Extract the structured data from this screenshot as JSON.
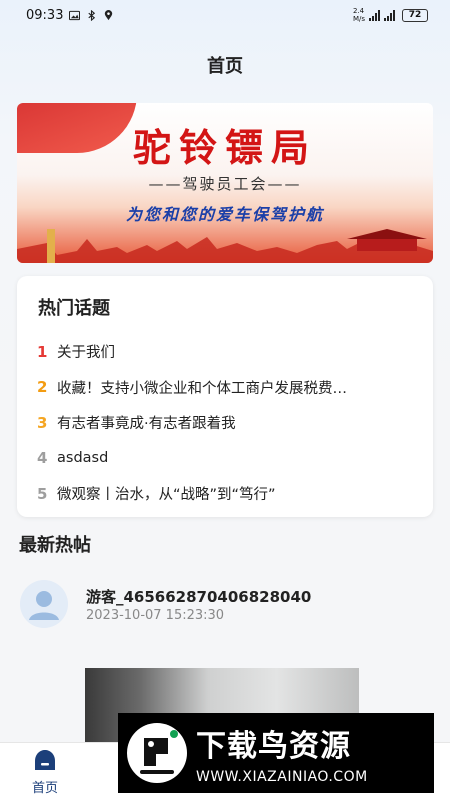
{
  "status_bar": {
    "time": "09:33",
    "net_speed": "2.4\nM/s",
    "battery": "72"
  },
  "header": {
    "title": "首页"
  },
  "banner": {
    "title": "驼铃镖局",
    "subtitle": "——驾驶员工会——",
    "slogan": "为您和您的爱车保驾护航"
  },
  "hot_topics": {
    "title": "热门话题",
    "items": [
      {
        "rank": "1",
        "text": "关于我们",
        "color": "#e53935"
      },
      {
        "rank": "2",
        "text": "收藏！支持小微企业和个体工商户发展税费…",
        "color": "#f39c12"
      },
      {
        "rank": "3",
        "text": "有志者事竟成·有志者跟着我",
        "color": "#f5a623"
      },
      {
        "rank": "4",
        "text": "asdasd",
        "color": "#9e9e9e"
      },
      {
        "rank": "5",
        "text": "微观察丨治水，从“战略”到“笃行”",
        "color": "#9e9e9e"
      }
    ]
  },
  "latest_posts": {
    "title": "最新热帖",
    "post": {
      "author": "游客_465662870406828040",
      "time": "2023-10-07 15:23:30"
    }
  },
  "bottom_nav": {
    "home_label": "首页",
    "accent": "#1c3f7a"
  },
  "watermark": {
    "title": "下载鸟资源",
    "url": "WWW.XIAZAINIAO.COM"
  }
}
